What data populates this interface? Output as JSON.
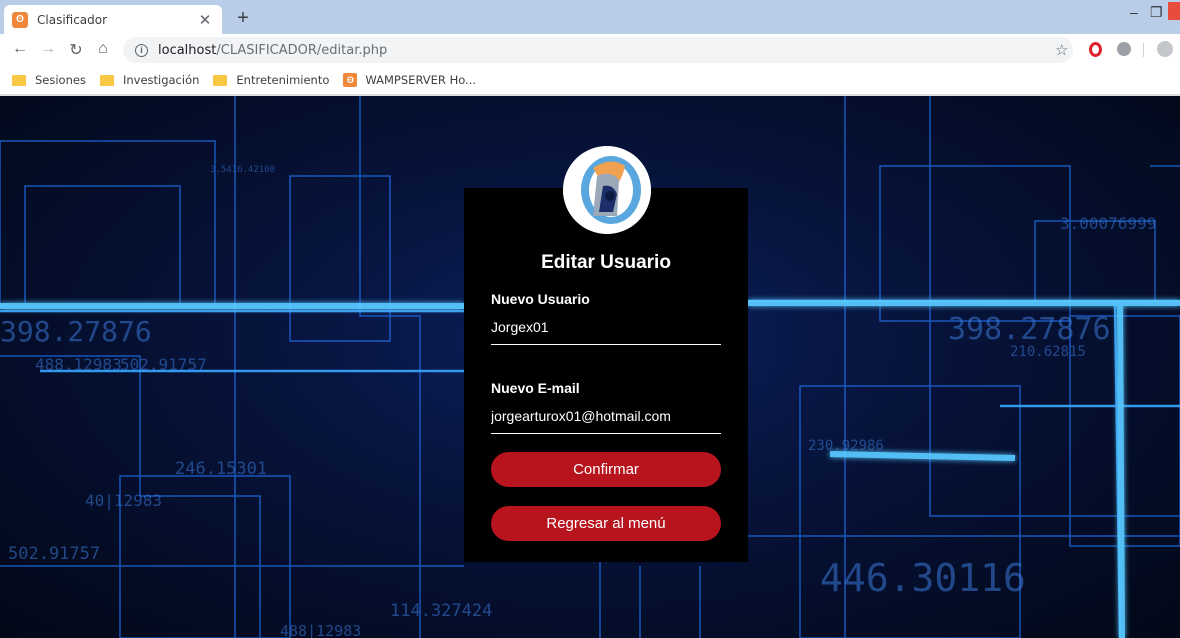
{
  "browser": {
    "tab_title": "Clasificador",
    "tab_favicon": "xampp-icon",
    "new_tab_label": "+",
    "url_host": "localhost",
    "url_path": "/CLASIFICADOR/editar.php",
    "bookmarks": [
      {
        "label": "Sesiones",
        "icon": "folder-icon"
      },
      {
        "label": "Investigación",
        "icon": "folder-icon"
      },
      {
        "label": "Entretenimiento",
        "icon": "folder-icon"
      },
      {
        "label": "WAMPSERVER Ho...",
        "icon": "wampserver-icon"
      }
    ]
  },
  "background": {
    "numbers": [
      "398.27876",
      "488.12983",
      "502.91757",
      "446.30116",
      "114.327424",
      "230.92986",
      "488|12983",
      "502.91757",
      "40|12983",
      "246.15301",
      "210.62815",
      "3.5416.42160",
      "3.00076999",
      "398.27876"
    ]
  },
  "form": {
    "title": "Editar Usuario",
    "username_label": "Nuevo Usuario",
    "username_value": "Jorgex01",
    "email_label": "Nuevo E-mail",
    "email_value": "jorgearturox01@hotmail.com",
    "confirm_label": "Confirmar",
    "back_label": "Regresar al menú"
  },
  "colors": {
    "card_bg": "#000000",
    "button_bg": "#b8141e",
    "page_bg": "#061238",
    "circuit_line": "#1e90ff"
  }
}
